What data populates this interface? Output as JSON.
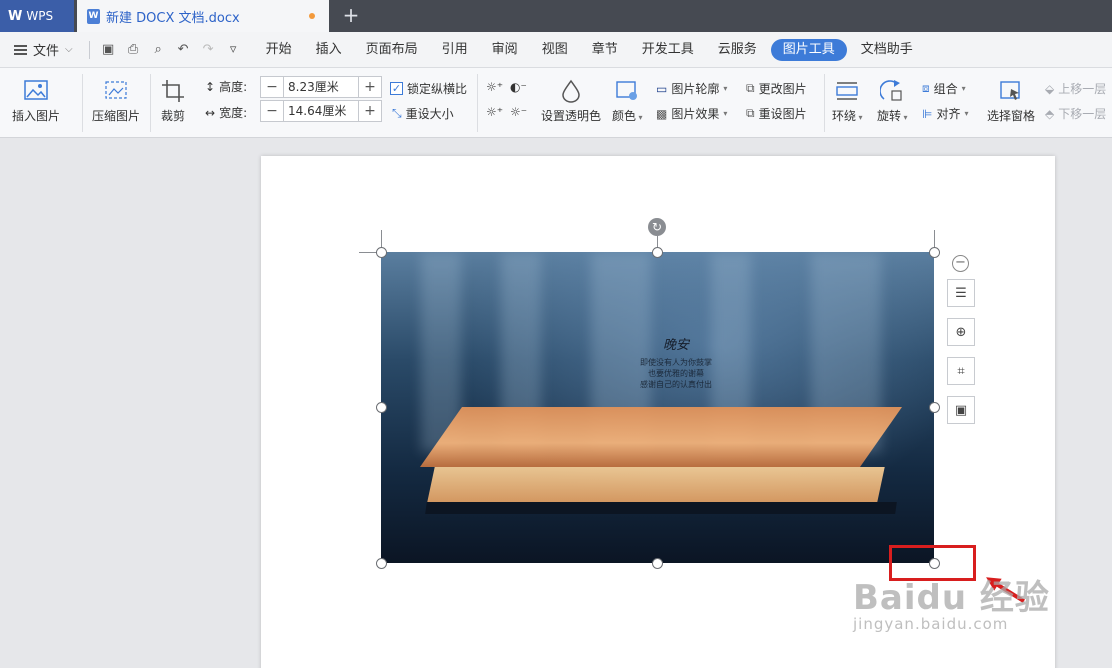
{
  "titlebar": {
    "app_tab": "WPS",
    "doc_tab": "新建 DOCX 文档.docx",
    "new_tab": "+"
  },
  "menubar": {
    "file": "文件",
    "items": [
      "开始",
      "插入",
      "页面布局",
      "引用",
      "审阅",
      "视图",
      "章节",
      "开发工具",
      "云服务",
      "图片工具",
      "文档助手"
    ],
    "active": "图片工具"
  },
  "ribbon": {
    "insert_picture": "插入图片",
    "compress_picture": "压缩图片",
    "crop": "裁剪",
    "height_label": "高度:",
    "height_value": "8.23厘米",
    "width_label": "宽度:",
    "width_value": "14.64厘米",
    "lock_ratio": "锁定纵横比",
    "reset_size": "重设大小",
    "set_transparent": "设置透明色",
    "color": "颜色",
    "picture_outline": "图片轮廓",
    "picture_effects": "图片效果",
    "change_picture": "更改图片",
    "reset_picture": "重设图片",
    "wrap": "环绕",
    "rotate": "旋转",
    "group": "组合",
    "align": "对齐",
    "selection_pane": "选择窗格",
    "bring_forward": "上移一层",
    "send_backward": "下移一层"
  },
  "photo_text": {
    "title": "晚安",
    "lines": [
      "即使没有人为你鼓掌",
      "也要优雅的谢幕",
      "感谢自己的认真付出"
    ]
  },
  "watermark": {
    "brand": "Baidu 经验",
    "url": "jingyan.baidu.com"
  },
  "colors": {
    "accent": "#3d7bd8",
    "tab_blue": "#3b5ea8",
    "highlight_red": "#d81e1e"
  }
}
